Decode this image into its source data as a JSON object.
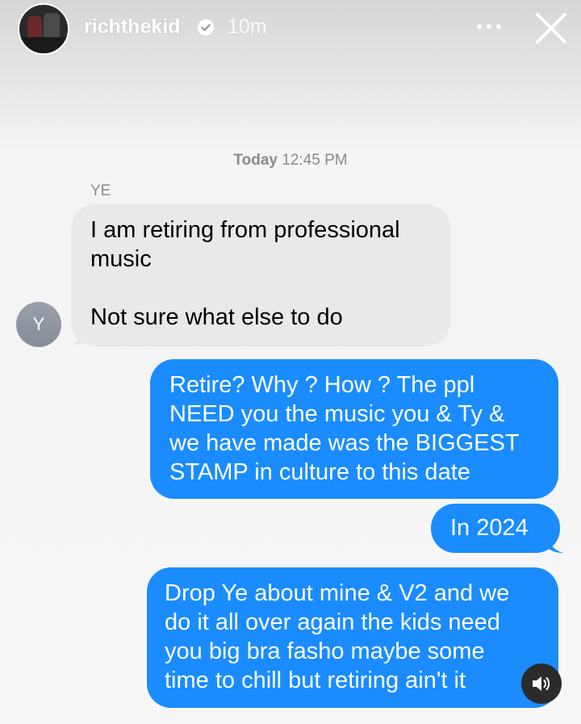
{
  "story": {
    "username": "richthekid",
    "time_ago": "10m",
    "verified": true,
    "icons": {
      "avatar": "profile-avatar",
      "verified": "verified-badge-icon",
      "more": "more-options-icon",
      "close": "close-icon",
      "sound": "speaker-icon"
    }
  },
  "conversation": {
    "timestamp_day": "Today",
    "timestamp_time": "12:45 PM",
    "sender_name": "YE",
    "sender_initial": "Y",
    "incoming_message": {
      "lines": [
        "I am retiring from professional",
        "music",
        "",
        "Not sure what else to do"
      ]
    },
    "outgoing_messages": [
      {
        "lines": [
          "Retire? Why ? How ? The ppl",
          "NEED you the music you & Ty &",
          "we have made was the BIGGEST",
          "STAMP in culture to this date"
        ]
      },
      {
        "lines": [
          "In 2024"
        ]
      },
      {
        "lines": [
          "Drop Ye about mine & V2 and we",
          "do it all over again the kids need",
          "you big bra fasho maybe some",
          "time to chill but retiring ain't it"
        ]
      }
    ]
  },
  "colors": {
    "outgoing_bubble": "#1a8cff",
    "incoming_bubble": "#e9e9eb",
    "timestamp_text": "#8a8a8f",
    "verified_badge": "#ffffff"
  }
}
